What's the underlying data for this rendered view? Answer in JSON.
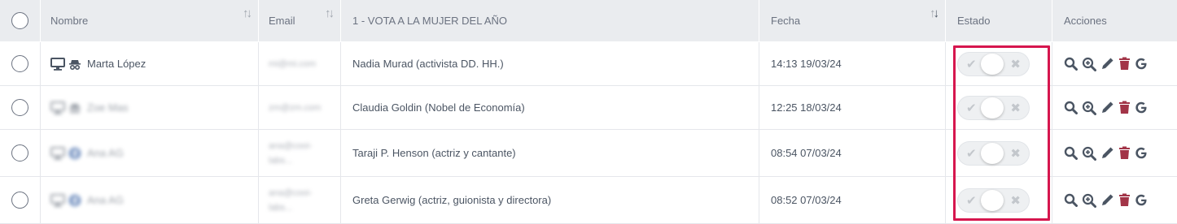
{
  "colors": {
    "header_bg": "#eaecef",
    "highlight": "#d6164e",
    "delete_icon": "#a23447",
    "icon_gray": "#4b5563"
  },
  "header": {
    "nombre": "Nombre",
    "email": "Email",
    "vote": "1 - VOTA A LA MUJER DEL AÑO",
    "fecha": "Fecha",
    "estado": "Estado",
    "acciones": "Acciones"
  },
  "rows": [
    {
      "name": "Marta López",
      "email": [
        "mi@mi.com"
      ],
      "vote": "Nadia Murad (activista DD. HH.)",
      "date": "14:13 19/03/24",
      "icons": [
        "desktop-icon",
        "incognito-icon"
      ],
      "blurred": false
    },
    {
      "name": "Zoe Mas",
      "email": [
        "zm@zm.com"
      ],
      "vote": "Claudia Goldin (Nobel de Economía)",
      "date": "12:25 18/03/24",
      "icons": [
        "desktop-icon",
        "incognito-icon"
      ],
      "blurred": true
    },
    {
      "name": "Ana AG",
      "email": [
        "ana@cooi-",
        "labs..."
      ],
      "vote": "Taraji P. Henson (actriz y cantante)",
      "date": "08:54 07/03/24",
      "icons": [
        "desktop-icon",
        "facebook-icon"
      ],
      "blurred": true
    },
    {
      "name": "Ana AG",
      "email": [
        "ana@cooi-",
        "labs..."
      ],
      "vote": "Greta Gerwig (actriz, guionista y directora)",
      "date": "08:52 07/03/24",
      "icons": [
        "desktop-icon",
        "facebook-icon"
      ],
      "blurred": true
    }
  ],
  "toggle": {
    "check": "✔",
    "cross": "✖"
  },
  "action_icons": [
    "search-icon",
    "zoom-in-icon",
    "edit-pencil-icon",
    "delete-trash-icon",
    "google-icon"
  ]
}
